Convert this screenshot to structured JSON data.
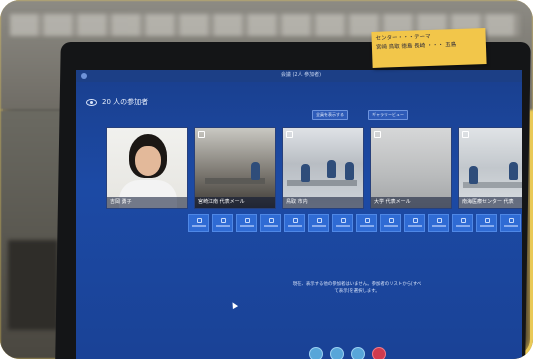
{
  "meeting": {
    "window_title": "会議 (2人 参加者)",
    "participants_label": "20 人の参加者",
    "buttons": [
      "全員を表示する",
      "ギャラリービュー"
    ]
  },
  "tiles": [
    {
      "name": "吉岡 勇子",
      "kind": "self"
    },
    {
      "name": "宮崎江南 代表メール",
      "kind": "room1"
    },
    {
      "name": "鳥取 市内",
      "kind": "room2"
    },
    {
      "name": "大学 代表メール",
      "kind": "room3"
    },
    {
      "name": "南海医療センター 代表",
      "kind": "room4"
    }
  ],
  "mini_tiles_count": 15,
  "notice": "現在、表示する他の参加者はいません。参加者のリストから[すべて表示]を選択します。",
  "sticky_note": "センター・・・テーマ\n宮崎  鳥取  徳島  長崎  ・・・  五島"
}
